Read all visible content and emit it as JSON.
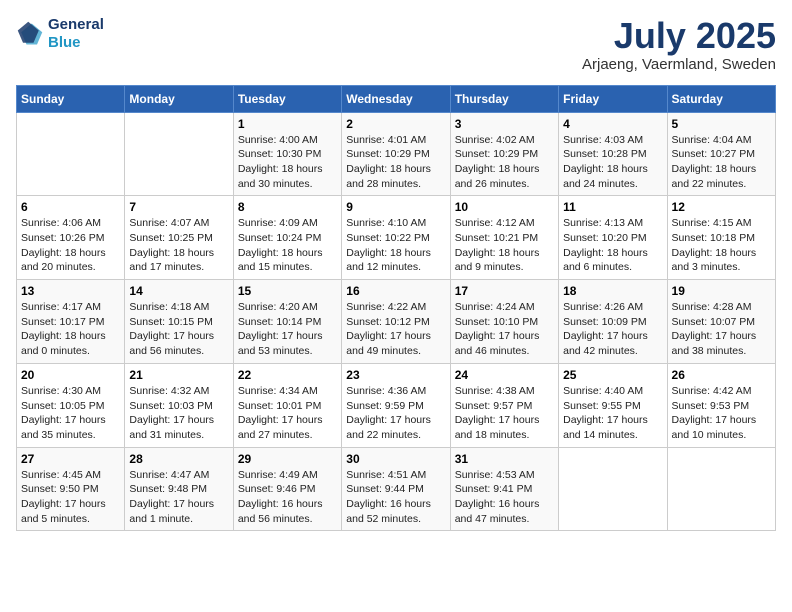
{
  "logo": {
    "line1": "General",
    "line2": "Blue"
  },
  "title": "July 2025",
  "location": "Arjaeng, Vaermland, Sweden",
  "weekdays": [
    "Sunday",
    "Monday",
    "Tuesday",
    "Wednesday",
    "Thursday",
    "Friday",
    "Saturday"
  ],
  "weeks": [
    [
      {
        "day": "",
        "info": ""
      },
      {
        "day": "",
        "info": ""
      },
      {
        "day": "1",
        "info": "Sunrise: 4:00 AM\nSunset: 10:30 PM\nDaylight: 18 hours and 30 minutes."
      },
      {
        "day": "2",
        "info": "Sunrise: 4:01 AM\nSunset: 10:29 PM\nDaylight: 18 hours and 28 minutes."
      },
      {
        "day": "3",
        "info": "Sunrise: 4:02 AM\nSunset: 10:29 PM\nDaylight: 18 hours and 26 minutes."
      },
      {
        "day": "4",
        "info": "Sunrise: 4:03 AM\nSunset: 10:28 PM\nDaylight: 18 hours and 24 minutes."
      },
      {
        "day": "5",
        "info": "Sunrise: 4:04 AM\nSunset: 10:27 PM\nDaylight: 18 hours and 22 minutes."
      }
    ],
    [
      {
        "day": "6",
        "info": "Sunrise: 4:06 AM\nSunset: 10:26 PM\nDaylight: 18 hours and 20 minutes."
      },
      {
        "day": "7",
        "info": "Sunrise: 4:07 AM\nSunset: 10:25 PM\nDaylight: 18 hours and 17 minutes."
      },
      {
        "day": "8",
        "info": "Sunrise: 4:09 AM\nSunset: 10:24 PM\nDaylight: 18 hours and 15 minutes."
      },
      {
        "day": "9",
        "info": "Sunrise: 4:10 AM\nSunset: 10:22 PM\nDaylight: 18 hours and 12 minutes."
      },
      {
        "day": "10",
        "info": "Sunrise: 4:12 AM\nSunset: 10:21 PM\nDaylight: 18 hours and 9 minutes."
      },
      {
        "day": "11",
        "info": "Sunrise: 4:13 AM\nSunset: 10:20 PM\nDaylight: 18 hours and 6 minutes."
      },
      {
        "day": "12",
        "info": "Sunrise: 4:15 AM\nSunset: 10:18 PM\nDaylight: 18 hours and 3 minutes."
      }
    ],
    [
      {
        "day": "13",
        "info": "Sunrise: 4:17 AM\nSunset: 10:17 PM\nDaylight: 18 hours and 0 minutes."
      },
      {
        "day": "14",
        "info": "Sunrise: 4:18 AM\nSunset: 10:15 PM\nDaylight: 17 hours and 56 minutes."
      },
      {
        "day": "15",
        "info": "Sunrise: 4:20 AM\nSunset: 10:14 PM\nDaylight: 17 hours and 53 minutes."
      },
      {
        "day": "16",
        "info": "Sunrise: 4:22 AM\nSunset: 10:12 PM\nDaylight: 17 hours and 49 minutes."
      },
      {
        "day": "17",
        "info": "Sunrise: 4:24 AM\nSunset: 10:10 PM\nDaylight: 17 hours and 46 minutes."
      },
      {
        "day": "18",
        "info": "Sunrise: 4:26 AM\nSunset: 10:09 PM\nDaylight: 17 hours and 42 minutes."
      },
      {
        "day": "19",
        "info": "Sunrise: 4:28 AM\nSunset: 10:07 PM\nDaylight: 17 hours and 38 minutes."
      }
    ],
    [
      {
        "day": "20",
        "info": "Sunrise: 4:30 AM\nSunset: 10:05 PM\nDaylight: 17 hours and 35 minutes."
      },
      {
        "day": "21",
        "info": "Sunrise: 4:32 AM\nSunset: 10:03 PM\nDaylight: 17 hours and 31 minutes."
      },
      {
        "day": "22",
        "info": "Sunrise: 4:34 AM\nSunset: 10:01 PM\nDaylight: 17 hours and 27 minutes."
      },
      {
        "day": "23",
        "info": "Sunrise: 4:36 AM\nSunset: 9:59 PM\nDaylight: 17 hours and 22 minutes."
      },
      {
        "day": "24",
        "info": "Sunrise: 4:38 AM\nSunset: 9:57 PM\nDaylight: 17 hours and 18 minutes."
      },
      {
        "day": "25",
        "info": "Sunrise: 4:40 AM\nSunset: 9:55 PM\nDaylight: 17 hours and 14 minutes."
      },
      {
        "day": "26",
        "info": "Sunrise: 4:42 AM\nSunset: 9:53 PM\nDaylight: 17 hours and 10 minutes."
      }
    ],
    [
      {
        "day": "27",
        "info": "Sunrise: 4:45 AM\nSunset: 9:50 PM\nDaylight: 17 hours and 5 minutes."
      },
      {
        "day": "28",
        "info": "Sunrise: 4:47 AM\nSunset: 9:48 PM\nDaylight: 17 hours and 1 minute."
      },
      {
        "day": "29",
        "info": "Sunrise: 4:49 AM\nSunset: 9:46 PM\nDaylight: 16 hours and 56 minutes."
      },
      {
        "day": "30",
        "info": "Sunrise: 4:51 AM\nSunset: 9:44 PM\nDaylight: 16 hours and 52 minutes."
      },
      {
        "day": "31",
        "info": "Sunrise: 4:53 AM\nSunset: 9:41 PM\nDaylight: 16 hours and 47 minutes."
      },
      {
        "day": "",
        "info": ""
      },
      {
        "day": "",
        "info": ""
      }
    ]
  ]
}
